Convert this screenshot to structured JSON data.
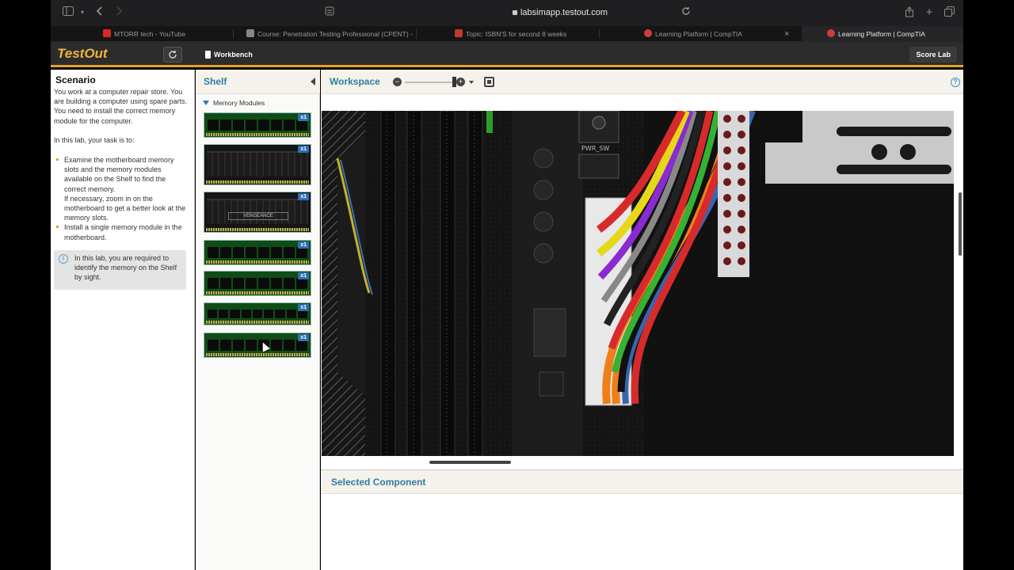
{
  "browser": {
    "url": "labsimapp.testout.com",
    "tabs": [
      {
        "title": "MTORR tech - YouTube",
        "favicon_color": "#e02626"
      },
      {
        "title": "Course: Penetration Testing Professional (CPENT) - Pr...",
        "favicon_color": "#888888"
      },
      {
        "title": "Topic: ISBN'S for second 8 weeks",
        "favicon_color": "#c0392b"
      },
      {
        "title": "Learning Platform | CompTIA",
        "favicon_color": "#d23b3b"
      },
      {
        "title": "Learning Platform | CompTIA",
        "favicon_color": "#d23b3b"
      }
    ]
  },
  "app": {
    "logo": "TestOut",
    "workbench_label": "Workbench",
    "score_label": "Score Lab",
    "accent": "#e6a22a"
  },
  "scenario": {
    "title": "Scenario",
    "intro": "You work at a computer repair store. You are building a computer using spare parts. You need to install the correct memory module for the computer.",
    "task_lead": "In this lab, your task is to:",
    "tasks": [
      {
        "main": "Examine the motherboard memory slots and the memory modules available on the Shelf to find the correct memory.",
        "sub": "If necessary, zoom in on the motherboard to get a better look at the memory slots."
      },
      {
        "main": "Install a single memory module in the motherboard.",
        "sub": ""
      }
    ],
    "note": "In this lab, you are required to identify the memory on the Shelf by sight."
  },
  "shelf": {
    "title": "Shelf",
    "category": "Memory Modules",
    "modules": [
      {
        "qty": "x1",
        "style": "green"
      },
      {
        "qty": "x1",
        "style": "heat",
        "brand": ""
      },
      {
        "qty": "x1",
        "style": "heat",
        "brand": "VENGEANCE"
      },
      {
        "qty": "x1",
        "style": "green"
      },
      {
        "qty": "x1",
        "style": "green"
      },
      {
        "qty": "x1",
        "style": "green"
      },
      {
        "qty": "x1",
        "style": "green"
      }
    ]
  },
  "workspace": {
    "title": "Workspace",
    "zoom_out_symbol": "−",
    "zoom_in_symbol": "+",
    "help_symbol": "?",
    "board_label": "PWR_SW"
  },
  "selected_component": {
    "title": "Selected Component"
  },
  "icons": {
    "sidebar": "sidebar-icon",
    "back": "back-icon",
    "forward": "forward-icon",
    "lock": "lock-icon",
    "reload": "reload-icon",
    "share": "share-icon",
    "new_tab": "plus-icon",
    "tabs_overview": "tabs-icon"
  }
}
